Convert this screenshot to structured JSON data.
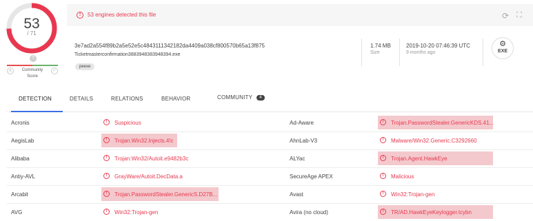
{
  "score": {
    "detected": "53",
    "total": "/ 71",
    "fraction": 0.746,
    "ring_color": "#e8384f",
    "track_color": "#e6e6e6"
  },
  "community": {
    "label": "Community\nScore",
    "face_icon": "question-face-icon",
    "x_icon": "close-icon",
    "check_icon": "check-icon"
  },
  "alert": {
    "text": "53 engines detected this file",
    "icon": "alert-circle-icon",
    "color": "#e8384f"
  },
  "toolbar": {
    "reanalyze_icon": "reanalyze-icon",
    "similar_icon": "similar-icon"
  },
  "file": {
    "hash": "3e7ad2a554f89b2a5e52e5c4843111342182da4409a038cf800570b65a13f875",
    "name": "Ticketmasterconfirmation3883948383948394.exe",
    "tag": "peexe",
    "size_value": "1.74 MB",
    "size_label": "Size",
    "date_value": "2019-10-20 07:46:39 UTC",
    "date_label": "9 months ago",
    "type_label": "EXE",
    "type_icon": "exe-file-icon"
  },
  "tabs": {
    "detection": "DETECTION",
    "details": "DETAILS",
    "relations": "RELATIONS",
    "behavior": "BEHAVIOR",
    "community": "COMMUNITY",
    "community_count": "4"
  },
  "results": [
    {
      "left": {
        "engine": "Acronis",
        "result": "Suspicious",
        "highlight": false
      },
      "right": {
        "engine": "Ad-Aware",
        "result": "Trojan.PasswordStealer.GenericKDS.41...",
        "highlight": true
      }
    },
    {
      "left": {
        "engine": "AegisLab",
        "result": "Trojan.Win32.Injects.4!c",
        "highlight": true
      },
      "right": {
        "engine": "AhnLab-V3",
        "result": "Malware/Win32.Generic.C3292660",
        "highlight": false
      }
    },
    {
      "left": {
        "engine": "Alibaba",
        "result": "Trojan:Win32/Autoit.e9482b3c",
        "highlight": false
      },
      "right": {
        "engine": "ALYac",
        "result": "Trojan.Agent.HawkEye",
        "highlight": true
      }
    },
    {
      "left": {
        "engine": "Antiy-AVL",
        "result": "GrayWare/Autoit.DecData.a",
        "highlight": false
      },
      "right": {
        "engine": "SecureAge APEX",
        "result": "Malicious",
        "highlight": false
      }
    },
    {
      "left": {
        "engine": "Arcabit",
        "result": "Trojan.PasswordStealer.GenericS.D27B...",
        "highlight": true
      },
      "right": {
        "engine": "Avast",
        "result": "Win32:Trojan-gen",
        "highlight": false
      }
    },
    {
      "left": {
        "engine": "AVG",
        "result": "Win32:Trojan-gen",
        "highlight": false
      },
      "right": {
        "engine": "Avira (no cloud)",
        "result": "TR/AD.HawkEyeKeylogger.tcybn",
        "highlight": true
      }
    }
  ],
  "colors": {
    "detection": "#e8384f",
    "highlight": "#f4c9cd",
    "tab_accent": "#3c6ee8"
  }
}
